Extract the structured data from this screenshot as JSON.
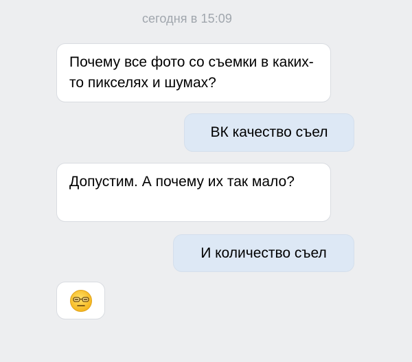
{
  "chat": {
    "timestamp": "сегодня в 15:09",
    "messages": [
      {
        "direction": "incoming",
        "text": "Почему все фото со съемки в каких-то пикселях и шумах?"
      },
      {
        "direction": "outgoing",
        "text": "ВК качество съел"
      },
      {
        "direction": "incoming",
        "text": "Допустим. А почему их так мало?"
      },
      {
        "direction": "outgoing",
        "text": "И количество съел"
      },
      {
        "direction": "incoming",
        "type": "emoji",
        "icon": "nerd-glasses-face-emoji"
      }
    ]
  },
  "colors": {
    "background": "#edeef0",
    "incoming_bubble": "#ffffff",
    "outgoing_bubble": "#dde8f5",
    "timestamp_text": "#a0a6ad",
    "emoji_face": "#ffcc33"
  }
}
